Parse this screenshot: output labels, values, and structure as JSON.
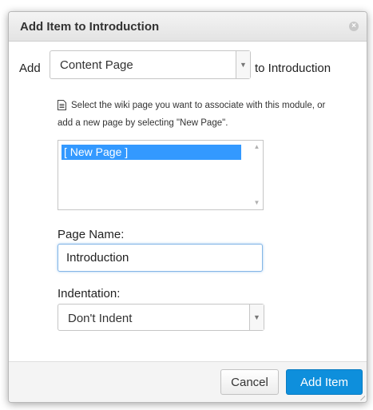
{
  "dialog": {
    "title": "Add Item to Introduction",
    "close_icon": "close-icon"
  },
  "add_row": {
    "add_label": "Add",
    "item_type": "Content Page",
    "to_label": "to Introduction"
  },
  "hint": {
    "icon": "document-icon",
    "text": "Select the wiki page you want to associate with this module, or add a new page by selecting \"New Page\"."
  },
  "page_list": {
    "options": [
      "[ New Page ]"
    ],
    "selected_index": 0
  },
  "page_name": {
    "label": "Page Name:",
    "value": "Introduction"
  },
  "indentation": {
    "label": "Indentation:",
    "value": "Don't Indent"
  },
  "footer": {
    "cancel_label": "Cancel",
    "add_item_label": "Add Item"
  },
  "colors": {
    "primary_button": "#0e8fdc",
    "selection": "#3399ff",
    "focus_border": "#84b6e6"
  }
}
